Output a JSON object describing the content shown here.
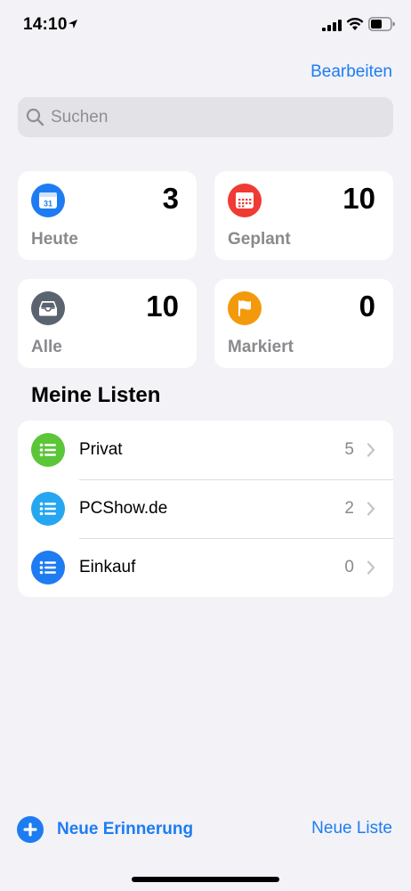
{
  "status_bar": {
    "time": "14:10",
    "icons": [
      "location-arrow-icon",
      "signal-icon",
      "wifi-icon",
      "battery-icon"
    ]
  },
  "header": {
    "edit_label": "Bearbeiten"
  },
  "search": {
    "placeholder": "Suchen",
    "value": ""
  },
  "smart_lists": [
    {
      "label": "Heute",
      "count": "3",
      "icon": "calendar-today-icon",
      "color": "#1e7cf2",
      "icon_text": "31"
    },
    {
      "label": "Geplant",
      "count": "10",
      "icon": "calendar-scheduled-icon",
      "color": "#ef3b33"
    },
    {
      "label": "Alle",
      "count": "10",
      "icon": "tray-icon",
      "color": "#5b6370"
    },
    {
      "label": "Markiert",
      "count": "0",
      "icon": "flag-icon",
      "color": "#f39a0c"
    }
  ],
  "my_lists": {
    "title": "Meine Listen",
    "items": [
      {
        "name": "Privat",
        "count": "5",
        "color": "#5bc637"
      },
      {
        "name": "PCShow.de",
        "count": "2",
        "color": "#26a6f0"
      },
      {
        "name": "Einkauf",
        "count": "0",
        "color": "#1e7cf2"
      }
    ]
  },
  "toolbar": {
    "new_reminder_label": "Neue Erinnerung",
    "new_list_label": "Neue Liste"
  },
  "colors": {
    "accent": "#1e7cf2",
    "background": "#f2f2f7"
  }
}
